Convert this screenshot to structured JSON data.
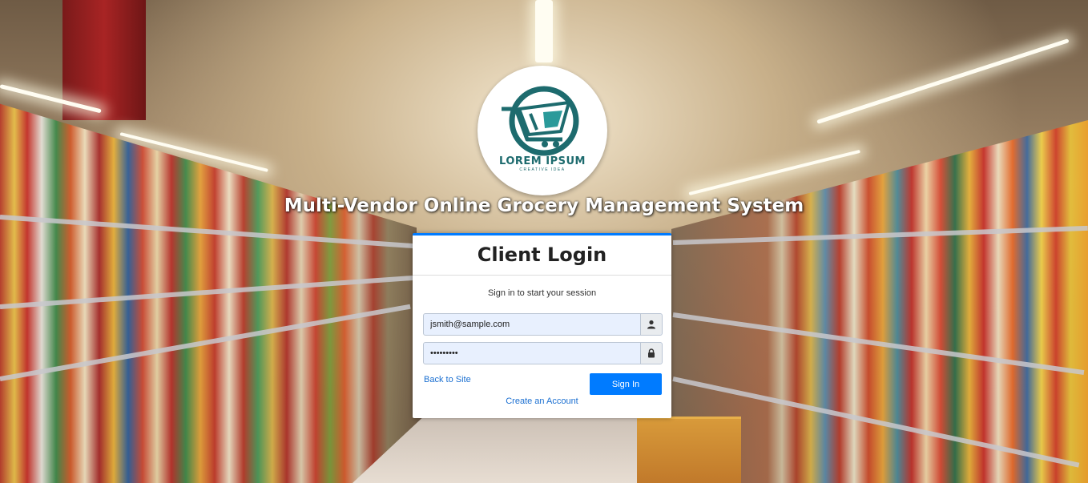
{
  "background": {
    "description_icon": "supermarket-aisle-photo"
  },
  "logo": {
    "icon": "shopping-cart-icon",
    "name": "LOREM IPSUM",
    "tagline": "CREATIVE IDEA",
    "color": "#1d6b6e"
  },
  "system_title": "Multi-Vendor Online Grocery Management System",
  "login": {
    "title": "Client Login",
    "subtitle": "Sign in to start your session",
    "email_value": "jsmith@sample.com",
    "password_value": "•••••••••",
    "email_icon": "user-icon",
    "password_icon": "lock-icon",
    "back_link": "Back to Site",
    "submit_label": "Sign In",
    "create_link": "Create an Account",
    "accent_color": "#007bff"
  }
}
